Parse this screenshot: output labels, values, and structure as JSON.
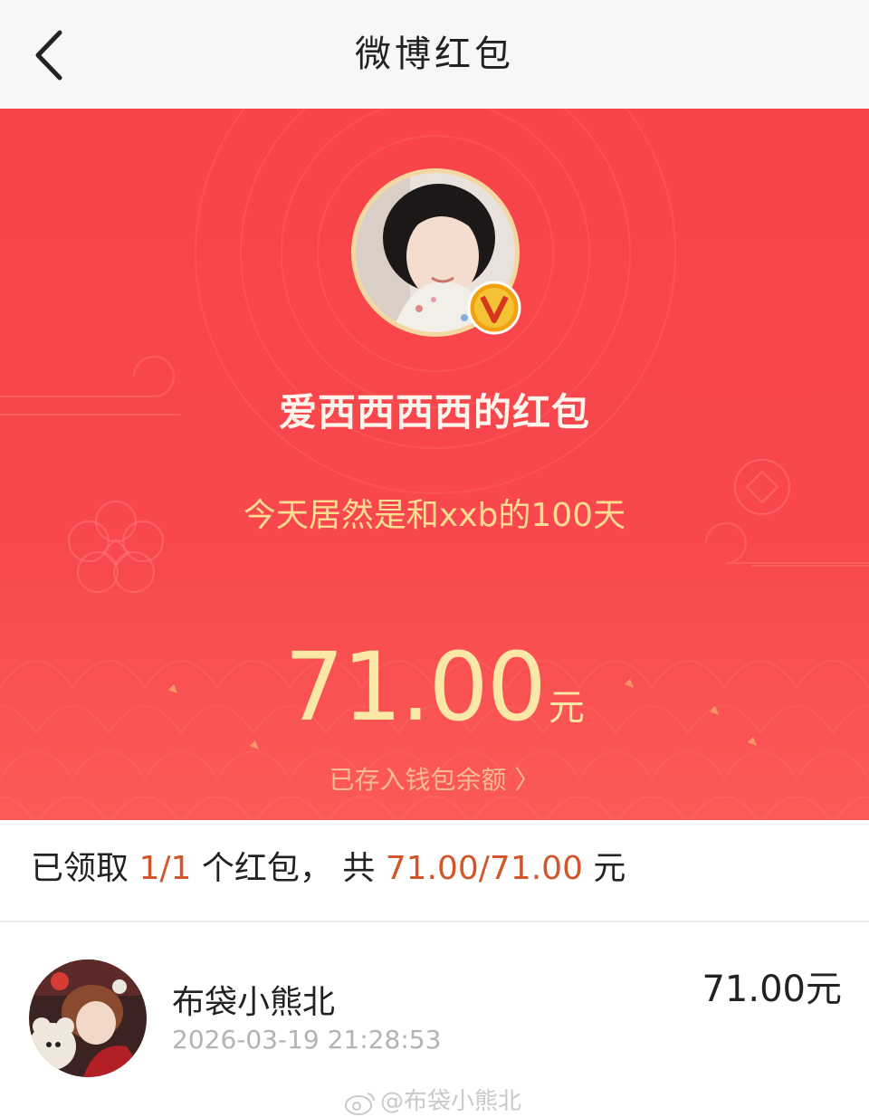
{
  "header": {
    "title": "微博红包"
  },
  "hero": {
    "sender_name": "爱西西西西的红包",
    "message": "今天居然是和xxb的100天",
    "amount": "71.00",
    "currency_unit": "元",
    "wallet_link_label": "已存入钱包余额 〉",
    "verified_badge_icon": "v-verified-icon"
  },
  "summary": {
    "prefix": "已领取 ",
    "claimed": "1/1",
    "middle": " 个红包， 共 ",
    "total": "71.00/71.00",
    "suffix": " 元"
  },
  "records": [
    {
      "name": "布袋小熊北",
      "time": "2026-03-19 21:28:53",
      "amount": "71.00元"
    }
  ],
  "watermark": "@布袋小熊北",
  "colors": {
    "hero_red": "#f8444a",
    "gold_text": "#fbe7a6",
    "highlight": "#d2562b"
  }
}
